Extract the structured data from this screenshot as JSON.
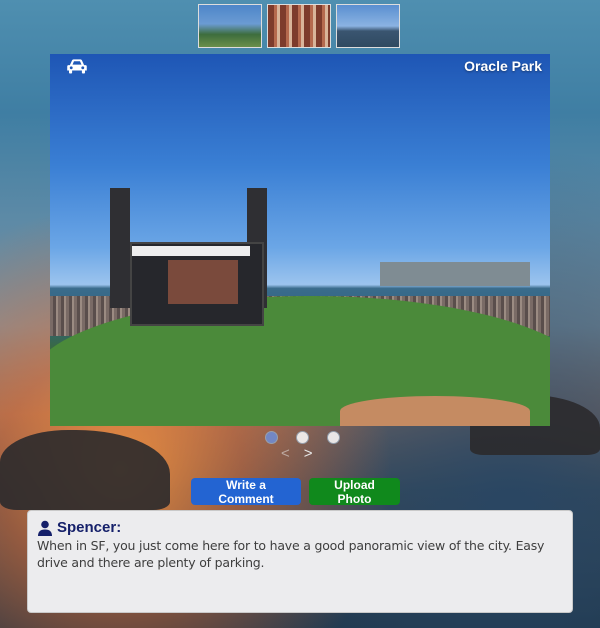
{
  "gallery": {
    "thumbnails": [
      {
        "name": "ballpark-thumbnail"
      },
      {
        "name": "brick-building-thumbnail"
      },
      {
        "name": "bay-pier-thumbnail"
      }
    ]
  },
  "viewer": {
    "title": "Oracle Park",
    "category_icon": "car-icon",
    "slides_total": 3,
    "active_slide": 1,
    "prev_label": "<",
    "next_label": ">"
  },
  "actions": {
    "write_comment_label": "Write a Comment",
    "upload_photo_label": "Upload Photo"
  },
  "comment": {
    "user_icon": "user-icon",
    "author": "Spencer:",
    "text": "When in SF, you just come here for to have a good panoramic view of the city. Easy drive and there are plenty of parking."
  },
  "colors": {
    "primary_button": "#2364d2",
    "success_button": "#10891c",
    "author_name": "#15206a",
    "active_dot": "#6d8ed9"
  }
}
